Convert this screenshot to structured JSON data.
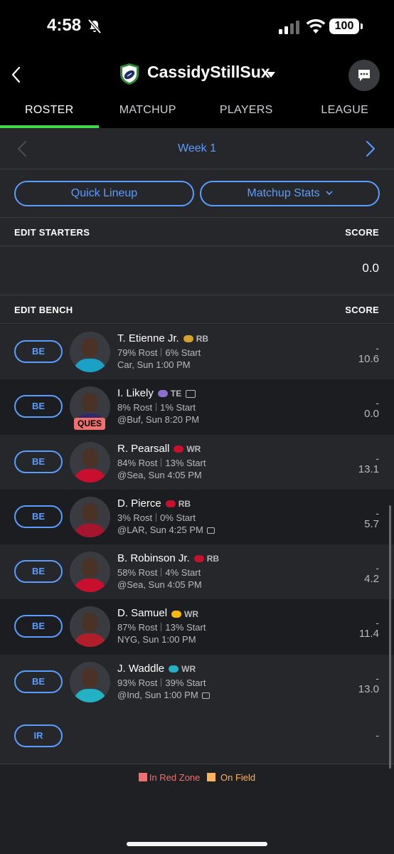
{
  "status_bar": {
    "time": "4:58",
    "battery": "100"
  },
  "header": {
    "team_name": "CassidyStillSux",
    "tabs": [
      {
        "label": "ROSTER",
        "active": true
      },
      {
        "label": "MATCHUP",
        "active": false
      },
      {
        "label": "PLAYERS",
        "active": false
      },
      {
        "label": "LEAGUE",
        "active": false
      }
    ]
  },
  "week": {
    "label": "Week 1"
  },
  "actions": {
    "quick_lineup": "Quick Lineup",
    "matchup_stats": "Matchup Stats"
  },
  "starters": {
    "title": "EDIT STARTERS",
    "score_header": "SCORE",
    "total": "0.0"
  },
  "bench": {
    "title": "EDIT BENCH",
    "score_header": "SCORE",
    "players": [
      {
        "slot": "BE",
        "name": "T. Etienne Jr.",
        "position": "RB",
        "team_icon": "jaguars-icon",
        "team_color": "#d7a22a",
        "rost": "79% Rost",
        "start": "6% Start",
        "game": "Car, Sun 1:00 PM",
        "tv": false,
        "news": false,
        "status": "",
        "dash": "-",
        "proj": "10.6",
        "jersey": "#1aa2c4"
      },
      {
        "slot": "BE",
        "name": "I. Likely",
        "position": "TE",
        "team_icon": "ravens-icon",
        "team_color": "#8b6fd1",
        "rost": "8% Rost",
        "start": "1% Start",
        "game": "@Buf, Sun 8:20 PM",
        "tv": false,
        "news": true,
        "status": "QUES",
        "dash": "-",
        "proj": "0.0",
        "jersey": "#2f2b6b"
      },
      {
        "slot": "BE",
        "name": "R. Pearsall",
        "position": "WR",
        "team_icon": "49ers-icon",
        "team_color": "#c8102e",
        "rost": "84% Rost",
        "start": "13% Start",
        "game": "@Sea, Sun 4:05 PM",
        "tv": false,
        "news": false,
        "status": "",
        "dash": "-",
        "proj": "13.1",
        "jersey": "#c8102e"
      },
      {
        "slot": "BE",
        "name": "D. Pierce",
        "position": "RB",
        "team_icon": "texans-icon",
        "team_color": "#c8102e",
        "rost": "3% Rost",
        "start": "0% Start",
        "game": "@LAR, Sun 4:25 PM",
        "tv": true,
        "news": false,
        "status": "",
        "dash": "-",
        "proj": "5.7",
        "jersey": "#a3162e"
      },
      {
        "slot": "BE",
        "name": "B. Robinson Jr.",
        "position": "RB",
        "team_icon": "49ers-icon",
        "team_color": "#c8102e",
        "rost": "58% Rost",
        "start": "4% Start",
        "game": "@Sea, Sun 4:05 PM",
        "tv": false,
        "news": false,
        "status": "",
        "dash": "-",
        "proj": "4.2",
        "jersey": "#c8102e"
      },
      {
        "slot": "BE",
        "name": "D. Samuel",
        "position": "WR",
        "team_icon": "commanders-icon",
        "team_color": "#ffb612",
        "rost": "87% Rost",
        "start": "13% Start",
        "game": "NYG, Sun 1:00 PM",
        "tv": false,
        "news": false,
        "status": "",
        "dash": "-",
        "proj": "11.4",
        "jersey": "#b01e2b"
      },
      {
        "slot": "BE",
        "name": "J. Waddle",
        "position": "WR",
        "team_icon": "dolphins-icon",
        "team_color": "#23b2c4",
        "rost": "93% Rost",
        "start": "39% Start",
        "game": "@Ind, Sun 1:00 PM",
        "tv": true,
        "news": false,
        "status": "",
        "dash": "-",
        "proj": "13.0",
        "jersey": "#23b2c4"
      }
    ]
  },
  "ir": {
    "slot": "IR",
    "dash": "-"
  },
  "legend": {
    "red_zone": "In Red Zone",
    "on_field": "On Field",
    "red_color": "#f06f6f",
    "field_color": "#ffb45c"
  }
}
